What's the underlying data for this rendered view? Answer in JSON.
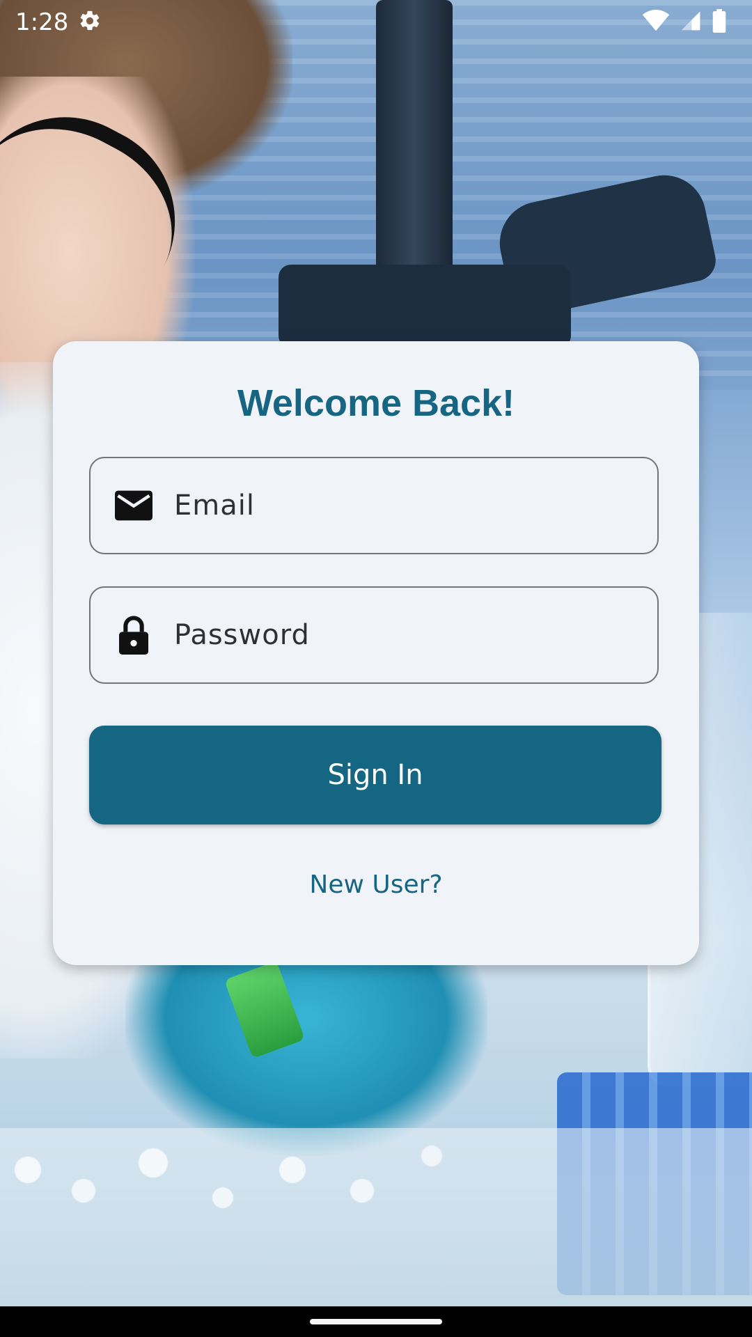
{
  "status_bar": {
    "time": "1:28",
    "icons": [
      "gear-icon",
      "wifi-icon",
      "signal-icon",
      "battery-icon"
    ]
  },
  "login_card": {
    "title": "Welcome Back!",
    "email_placeholder": "Email",
    "password_placeholder": "Password",
    "sign_in_label": "Sign In",
    "new_user_label": "New User?"
  },
  "colors": {
    "accent": "#156682",
    "card_background": "#f0f3f8",
    "field_border": "#6f757b"
  },
  "icons": {
    "email_field": "mail-icon",
    "password_field": "lock-icon"
  }
}
